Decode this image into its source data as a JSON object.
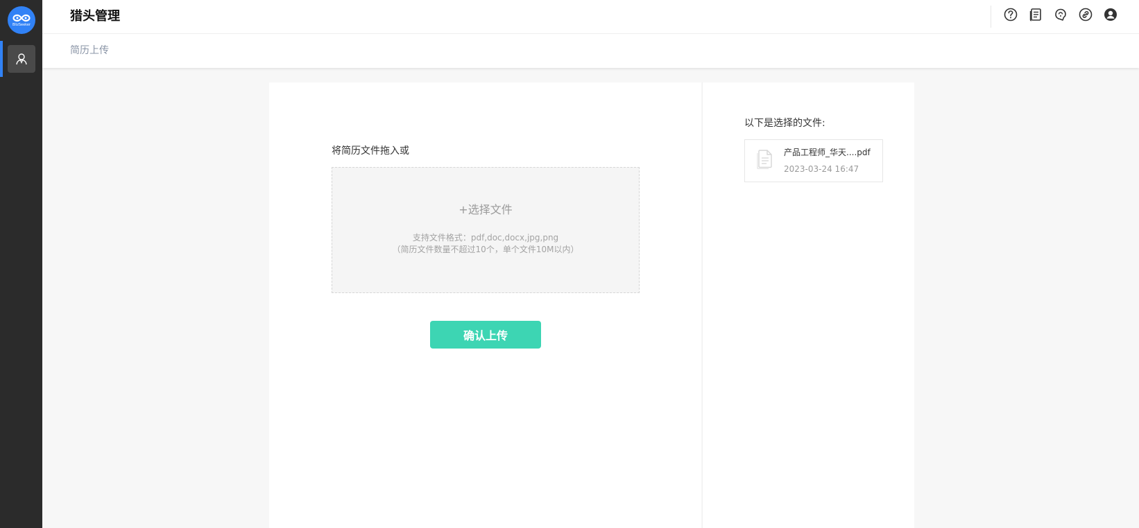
{
  "app": {
    "logo_text": "BlizSeeker"
  },
  "header": {
    "title": "猎头管理",
    "icons": [
      "help-icon",
      "document-icon",
      "support-icon",
      "link-icon",
      "user-icon"
    ]
  },
  "breadcrumb": {
    "current": "简历上传"
  },
  "upload": {
    "drag_label": "将简历文件拖入或",
    "choose_file": "+选择文件",
    "support_text": "支持文件格式：pdf,doc,docx,jpg,png",
    "limit_text": "（简历文件数量不超过10个，单个文件10M以内）",
    "confirm_button": "确认上传"
  },
  "selected": {
    "label": "以下是选择的文件:",
    "files": [
      {
        "name": "产品工程师_华天....pdf",
        "time": "2023-03-24 16:47"
      }
    ]
  },
  "colors": {
    "accent": "#3182f6",
    "confirm": "#3dd5b3",
    "sidebar": "#2b2b2b"
  }
}
